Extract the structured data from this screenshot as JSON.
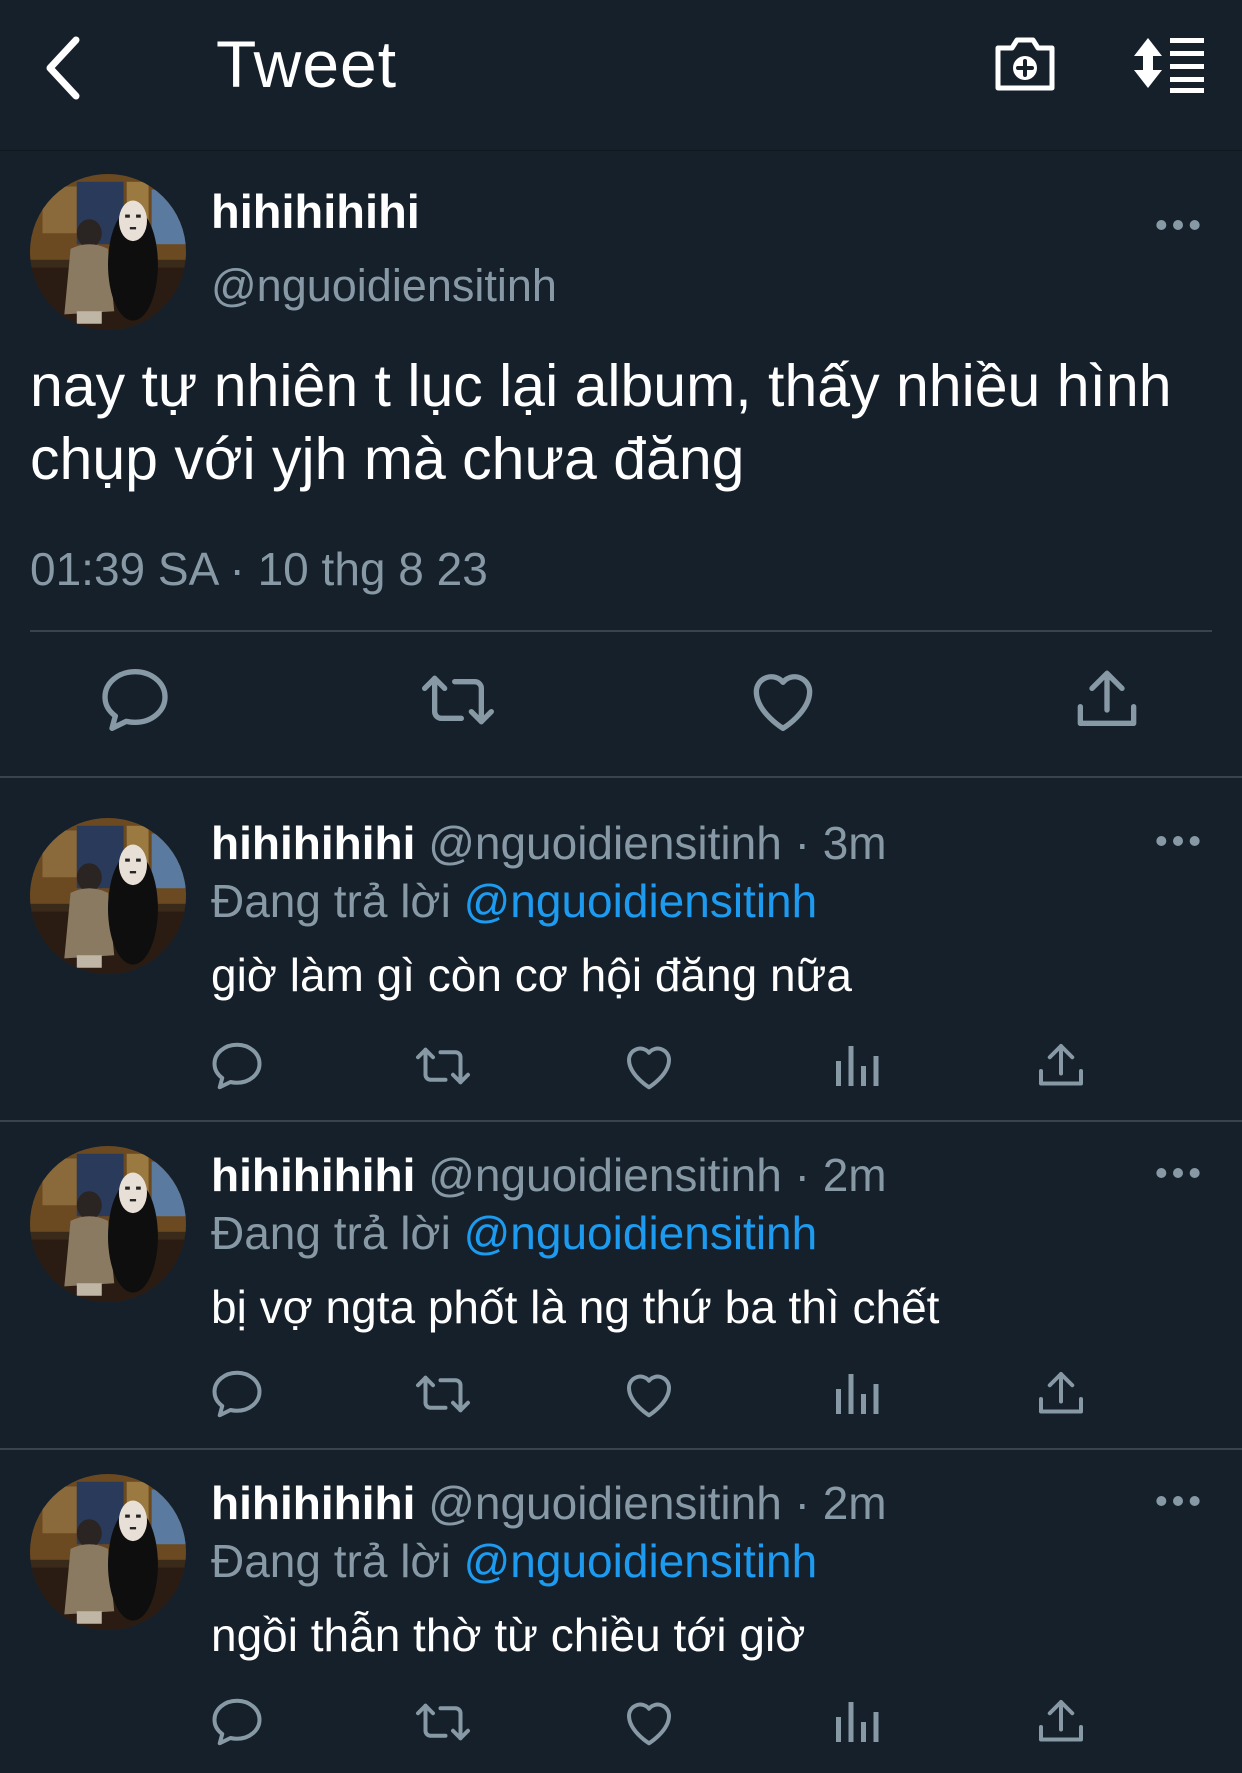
{
  "header": {
    "title": "Tweet",
    "back_icon": "chevron-left-icon",
    "camera_icon": "camera-add-icon",
    "sort_icon": "sort-list-icon"
  },
  "colors": {
    "background": "#15202b",
    "secondary_text": "#8899a6",
    "link": "#1d9bf0",
    "divider": "#38444d"
  },
  "main_tweet": {
    "name": "hihihihihi",
    "handle": "@nguoidiensitinh",
    "text": "nay tự nhiên t lục lại album, thấy nhiều hình chụp với yjh mà chưa đăng",
    "time": "01:39 SA · 10 thg 8 23",
    "actions": [
      "reply-icon",
      "retweet-icon",
      "like-icon",
      "share-icon"
    ]
  },
  "replies": [
    {
      "name": "hihihihihi",
      "handle": "@nguoidiensitinh",
      "sep": "·",
      "time": "3m",
      "replying_label": "Đang trả lời",
      "replying_to": "@nguoidiensitinh",
      "text": "giờ làm gì còn cơ hội đăng nữa"
    },
    {
      "name": "hihihihihi",
      "handle": "@nguoidiensitinh",
      "sep": "·",
      "time": "2m",
      "replying_label": "Đang trả lời",
      "replying_to": "@nguoidiensitinh",
      "text": "bị vợ ngta phốt là ng thứ ba thì chết"
    },
    {
      "name": "hihihihihi",
      "handle": "@nguoidiensitinh",
      "sep": "·",
      "time": "2m",
      "replying_label": "Đang trả lời",
      "replying_to": "@nguoidiensitinh",
      "text": "ngồi thẫn thờ từ chiều tới giờ"
    }
  ]
}
